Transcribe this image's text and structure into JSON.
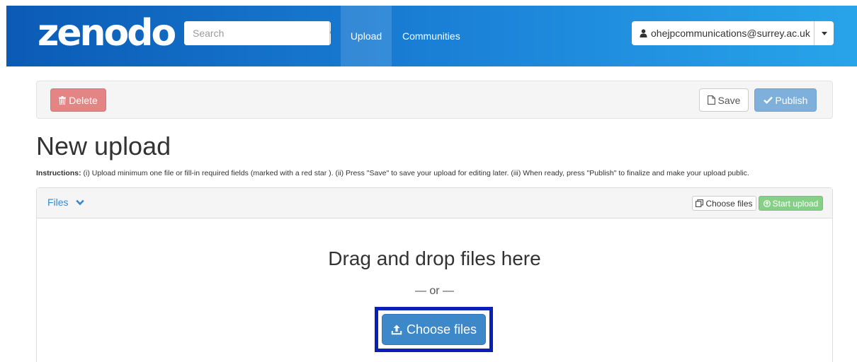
{
  "header": {
    "logo_text": "zenodo",
    "search_placeholder": "Search",
    "nav": {
      "upload_label": "Upload",
      "communities_label": "Communities"
    },
    "user_email": "ohejpcommunications@surrey.ac.uk"
  },
  "toolbar": {
    "delete_label": "Delete",
    "save_label": "Save",
    "publish_label": "Publish"
  },
  "page": {
    "title": "New upload",
    "instructions_prefix": "Instructions:",
    "instructions_text": "(i) Upload minimum one file or fill-in required fields (marked with a red star ). (ii) Press \"Save\" to save your upload for editing later. (iii) When ready, press \"Publish\" to finalize and make your upload public."
  },
  "files_panel": {
    "header_label": "Files",
    "choose_files_small": "Choose files",
    "start_upload_label": "Start upload",
    "drop_title": "Drag and drop files here",
    "or_text": "— or —",
    "choose_files_big": "Choose files"
  },
  "colors": {
    "nav_gradient_start": "#0b5bb5",
    "nav_gradient_end": "#28a4ea",
    "delete": "#e28584",
    "publish": "#7fb0dc",
    "primary": "#3c88c9",
    "success": "#86cf86",
    "highlight_border": "#0a1fb8"
  },
  "icons": {
    "search": "search-icon",
    "user": "user-icon",
    "trash": "trash-icon",
    "file": "file-icon",
    "check": "check-icon",
    "chevron": "chevron-down-icon",
    "copy": "copy-icon",
    "upload_circle": "upload-circle-icon",
    "upload": "upload-icon"
  }
}
